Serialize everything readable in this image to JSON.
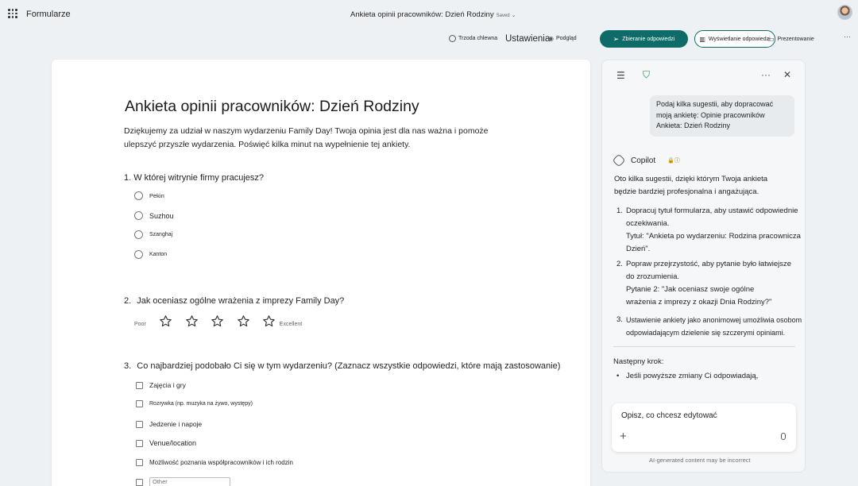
{
  "app": {
    "name": "Formularze"
  },
  "header": {
    "title": "Ankieta opinii pracowników: Dzień Rodziny",
    "saved": "Saved"
  },
  "toolbar": {
    "theme_label": "Trzoda chlewna",
    "settings_label": "Ustawienia",
    "preview_label": "Podgląd",
    "collect_label": "Zbieranie odpowiedzi",
    "view_label": "Wyświetlanie odpowiedzi",
    "present_label": "Prezentowanie"
  },
  "form": {
    "title": "Ankieta opinii pracowników: Dzień Rodziny",
    "description": "Dziękujemy za udział w naszym wydarzeniu Family Day! Twoja opinia jest dla nas ważna i pomoże ulepszyć przyszłe wydarzenia. Poświęć kilka minut na wypełnienie tej ankiety.",
    "q1": {
      "text": "1. W której witrynie firmy pracujesz?",
      "options": [
        "Pekin",
        "Suzhou",
        "Szanghaj",
        "Kanton"
      ]
    },
    "q2": {
      "number": "2.",
      "text": "Jak oceniasz ogólne wrażenia z imprezy Family Day?",
      "low_label": "Poor",
      "high_label": "Excellent",
      "stars": 5
    },
    "q3": {
      "number": "3.",
      "text": "Co najbardziej podobało Ci się w tym wydarzeniu? (Zaznacz wszystkie odpowiedzi, które mają zastosowanie)",
      "options": [
        "Zajęcia i gry",
        "Rozrywka (np. muzyka na żywo, występy)",
        "Jedzenie i napoje",
        "Venue/location",
        "Możliwość poznania współpracowników i ich rodzin"
      ],
      "other_placeholder": "Other"
    }
  },
  "copilot": {
    "user_message_lines": [
      "Podaj kilka sugestii, aby dopracować",
      "moją ankietę: Opinie pracowników",
      "Ankieta: Dzień Rodziny"
    ],
    "name": "Copilot",
    "intro_lines": [
      "Oto kilka sugestii, dzięki którym Twoja ankieta",
      "będzie bardziej profesjonalna i angażująca."
    ],
    "suggestions": [
      {
        "num": "1.",
        "lines": [
          "Dopracuj tytuł formularza, aby ustawić odpowiednie",
          "oczekiwania."
        ],
        "detail_lines": [
          "Tytuł: \"Ankieta po wydarzeniu: Rodzina pracownicza",
          "Dzień\"."
        ]
      },
      {
        "num": "2.",
        "lines": [
          "Popraw przejrzystość, aby pytanie było łatwiejsze",
          "do zrozumienia."
        ],
        "detail_lines": [
          "Pytanie 2: \"Jak oceniasz swoje ogólne",
          "wrażenia z imprezy z okazji Dnia Rodziny?\""
        ]
      },
      {
        "num": "3.",
        "lines": [
          "Ustawienie ankiety jako anonimowej umożliwia osobom",
          "odpowiadającym dzielenie się szczerymi opiniami."
        ],
        "detail_lines": []
      }
    ],
    "next_step_label": "Następny krok:",
    "next_step_bullet": "Jeśli powyższe zmiany Ci odpowiadają,",
    "prompt_placeholder": "Opisz, co chcesz edytować",
    "disclaimer": "AI-generated content may be incorrect"
  },
  "colors": {
    "accent": "#0f6b67",
    "page_bg": "#eef1f4",
    "panel_bg": "#f5f7f9"
  }
}
